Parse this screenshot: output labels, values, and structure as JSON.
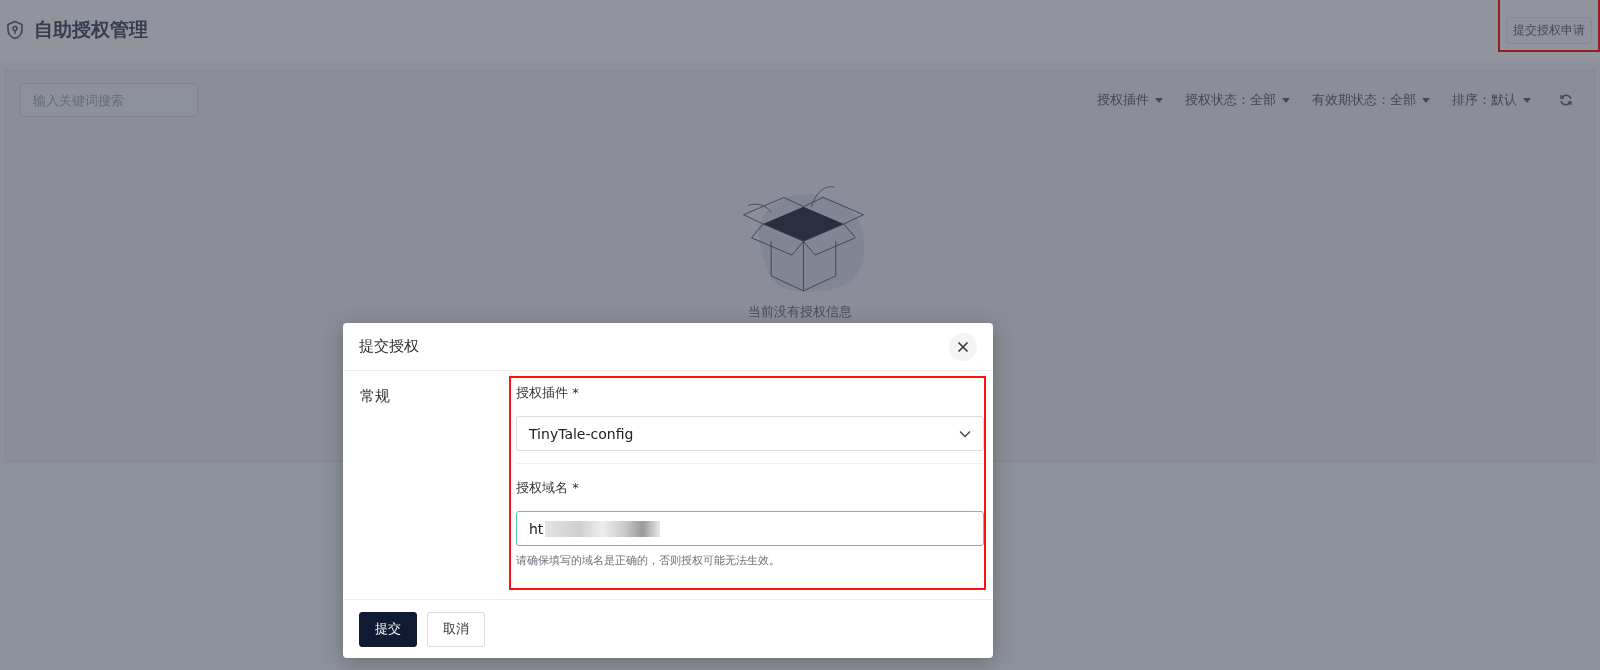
{
  "page": {
    "title": "自助授权管理",
    "submit_button": {
      "label": "提交授权申请",
      "highlighted": true
    }
  },
  "toolbar": {
    "search": {
      "placeholder": "输入关键词搜索"
    },
    "filters": [
      {
        "label": "授权插件"
      },
      {
        "label": "授权状态：全部"
      },
      {
        "label": "有效期状态：全部"
      },
      {
        "label": "排序：默认"
      }
    ]
  },
  "empty_state": {
    "message": "当前没有授权信息"
  },
  "dialog": {
    "title": "提交授权",
    "section": "常规",
    "form_highlighted": true,
    "fields": [
      {
        "kind": "select",
        "label": "授权插件 *",
        "value": "TinyTale-config",
        "focused": false
      },
      {
        "kind": "input",
        "label": "授权域名 *",
        "value": "ht",
        "redacted": true,
        "focused": true,
        "hint": "请确保填写的域名是正确的，否则授权可能无法生效。"
      }
    ],
    "buttons": [
      {
        "label": "提交",
        "primary": true
      },
      {
        "label": "取消",
        "primary": false
      }
    ]
  }
}
